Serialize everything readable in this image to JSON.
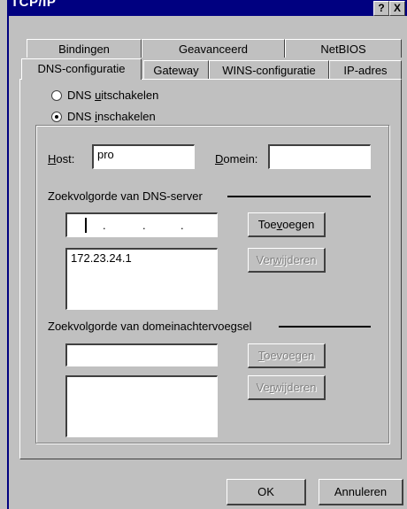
{
  "window": {
    "title": "TCP/IP",
    "help_label": "?",
    "close_label": "X"
  },
  "tabs_row1": [
    {
      "label": "Bindingen"
    },
    {
      "label": "Geavanceerd"
    },
    {
      "label": "NetBIOS"
    }
  ],
  "tabs_row2": [
    {
      "label": "DNS-configuratie",
      "active": true
    },
    {
      "label": "Gateway"
    },
    {
      "label": "WINS-configuratie"
    },
    {
      "label": "IP-adres"
    }
  ],
  "dns": {
    "disable_label": {
      "pre": "DNS ",
      "u": "u",
      "post": "itschakelen"
    },
    "enable_label": {
      "pre": "DNS ",
      "u": "i",
      "post": "nschakelen"
    },
    "selected": "enable"
  },
  "host": {
    "label": {
      "u": "H",
      "post": "ost:"
    },
    "value": "pro"
  },
  "domain": {
    "label": {
      "u": "D",
      "post": "omein:"
    },
    "value": ""
  },
  "dns_search": {
    "heading": "Zoekvolgorde van DNS-server",
    "ip_separators": [
      ".",
      ".",
      "."
    ],
    "add_label": {
      "pre": "Toe",
      "u": "v",
      "post": "oegen"
    },
    "remove_label": {
      "pre": "Ver",
      "u": "w",
      "post": "ijderen"
    },
    "entries": [
      "172.23.24.1"
    ]
  },
  "suffix_search": {
    "heading": "Zoekvolgorde van domeinachtervoegsel",
    "input_value": "",
    "add_label": {
      "pre": "",
      "u": "T",
      "post": "oevoegen"
    },
    "remove_label": {
      "pre": "Ve",
      "u": "r",
      "post": "wijderen"
    },
    "entries": []
  },
  "footer": {
    "ok_label": "OK",
    "cancel_label": "Annuleren"
  }
}
